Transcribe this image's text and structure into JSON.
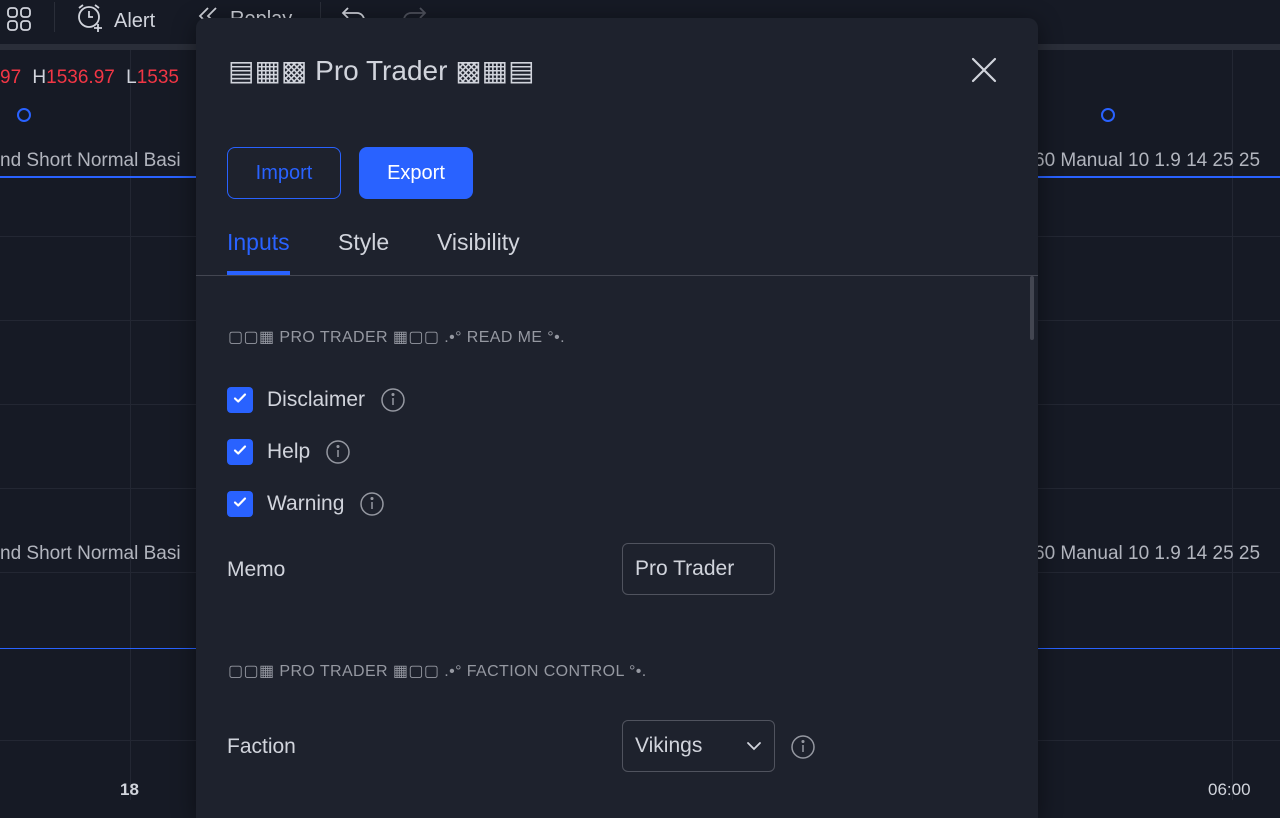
{
  "toolbar": {
    "alert_label": "Alert",
    "replay_label": "Replay"
  },
  "chart": {
    "ohlc_close_fragment": "97",
    "ohlc_h_label": "H",
    "ohlc_h_value": "1536.97",
    "ohlc_l_label": "L",
    "ohlc_l_value": "1535",
    "indicator_left_1": "nd Short Normal Basi",
    "indicator_right_1": "60 Manual 10 1.9 14 25 25",
    "indicator_left_2": "nd Short Normal Basi",
    "indicator_right_2": "60 Manual 10 1.9 14 25 25",
    "time_labels": [
      "18",
      "06:00"
    ]
  },
  "dialog": {
    "title": "▤▦▩ Pro Trader ▩▦▤",
    "import_label": "Import",
    "export_label": "Export",
    "tabs": [
      {
        "label": "Inputs",
        "active": true
      },
      {
        "label": "Style",
        "active": false
      },
      {
        "label": "Visibility",
        "active": false
      }
    ],
    "section_readme": "▢▢▦ PRO TRADER ▦▢▢ .•° READ ME °•.",
    "checkboxes": [
      {
        "label": "Disclaimer",
        "checked": true
      },
      {
        "label": "Help",
        "checked": true
      },
      {
        "label": "Warning",
        "checked": true
      }
    ],
    "memo_label": "Memo",
    "memo_value": "Pro Trader",
    "section_faction": "▢▢▦ PRO TRADER ▦▢▢ .•° FACTION CONTROL °•.",
    "faction_label": "Faction",
    "faction_value": "Vikings"
  },
  "colors": {
    "accent": "#2962ff",
    "red": "#f23645",
    "dialog_bg": "#1e222d",
    "page_bg": "#161a25"
  }
}
